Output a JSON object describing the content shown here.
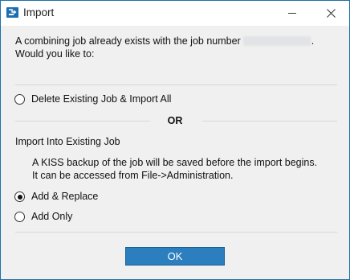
{
  "window": {
    "title": "Import",
    "icon": "app-icon"
  },
  "titlebar_buttons": {
    "minimize_icon": "minimize-icon",
    "close_icon": "close-icon"
  },
  "message": {
    "line1_prefix": "A combining job already exists with the job number",
    "line1_suffix": ".",
    "line2": "Would you like to:"
  },
  "options": {
    "delete_import_all": {
      "label": "Delete Existing Job & Import All",
      "selected": false
    },
    "or_label": "OR",
    "import_into_heading": "Import Into Existing Job",
    "backup_note_line1": "A KISS backup of the job will be saved before the import begins.",
    "backup_note_line2": "It can be accessed from File->Administration.",
    "add_replace": {
      "label": "Add & Replace",
      "selected": true
    },
    "add_only": {
      "label": "Add Only",
      "selected": false
    }
  },
  "footer": {
    "ok_label": "OK"
  },
  "colors": {
    "accent": "#2b7fbf",
    "border": "#1f6fa6",
    "background": "#f0f0f0"
  }
}
